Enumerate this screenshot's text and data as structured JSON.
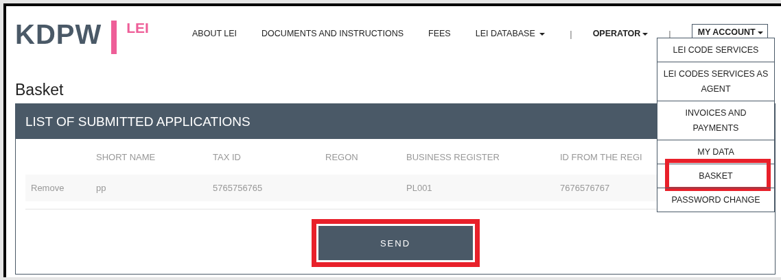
{
  "logo": {
    "brand": "KDPW",
    "product": "LEI"
  },
  "nav": [
    {
      "label": "ABOUT LEI",
      "kind": "link"
    },
    {
      "label": "DOCUMENTS AND INSTRUCTIONS",
      "kind": "link"
    },
    {
      "label": "FEES",
      "kind": "link"
    },
    {
      "label": "LEI DATABASE",
      "kind": "dropdown"
    },
    {
      "label": "|",
      "kind": "separator"
    },
    {
      "label": "OPERATOR",
      "kind": "user"
    },
    {
      "label": "|",
      "kind": "separator"
    },
    {
      "label": "MY ACCOUNT",
      "kind": "account"
    }
  ],
  "account_menu": [
    {
      "label": "LEI CODE SERVICES",
      "highlighted": false
    },
    {
      "label": "LEI CODES SERVICES AS AGENT",
      "highlighted": false
    },
    {
      "label": "INVOICES AND PAYMENTS",
      "highlighted": false
    },
    {
      "label": "MY DATA",
      "highlighted": false
    },
    {
      "label": "BASKET",
      "highlighted": true
    },
    {
      "label": "PASSWORD CHANGE",
      "highlighted": false
    }
  ],
  "page_title": "Basket",
  "panel": {
    "title": "LIST OF SUBMITTED APPLICATIONS",
    "columns": [
      "SHORT NAME",
      "TAX ID",
      "REGON",
      "BUSINESS REGISTER",
      "ID FROM THE REGI"
    ],
    "rows": [
      {
        "action": "Remove",
        "cells": [
          "pp",
          "5765756765",
          null,
          "PL001",
          "7676576767"
        ]
      }
    ],
    "send_button": {
      "label": "SEND",
      "highlighted": true
    }
  }
}
